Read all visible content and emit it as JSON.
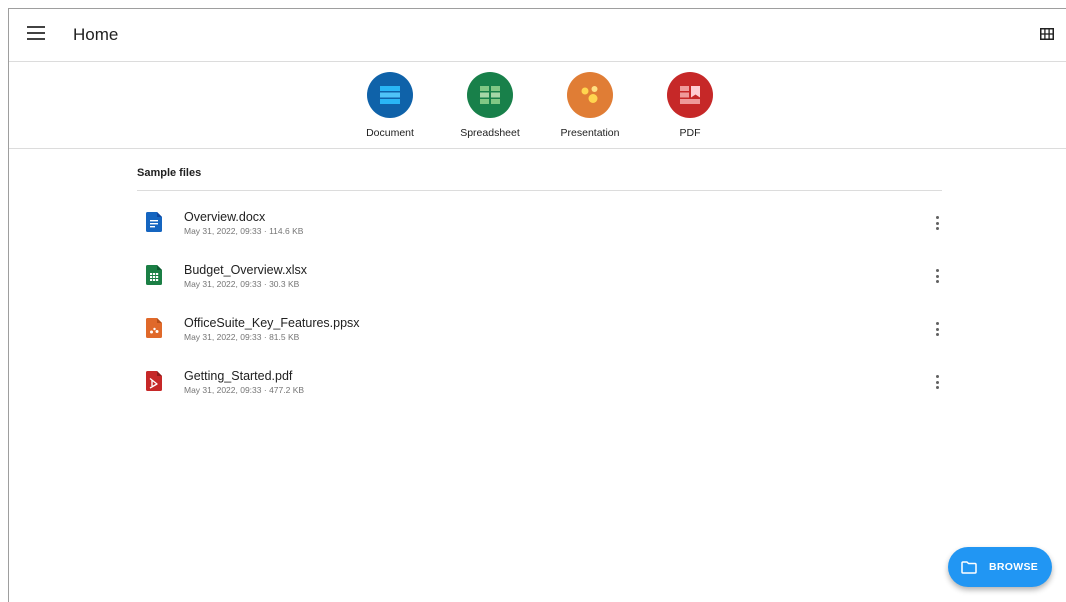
{
  "app": {
    "title": "Home"
  },
  "icons": {
    "menu": "menu-icon",
    "view_toggle": "grid-view-icon",
    "more": "more-vert-icon",
    "browse": "folder-icon"
  },
  "create": {
    "items": [
      {
        "label": "Document",
        "color": "#0f62a9",
        "icon": "document-icon"
      },
      {
        "label": "Spreadsheet",
        "color": "#18804a",
        "icon": "spreadsheet-icon"
      },
      {
        "label": "Presentation",
        "color": "#e07d35",
        "icon": "presentation-icon"
      },
      {
        "label": "PDF",
        "color": "#c62828",
        "icon": "pdf-icon"
      }
    ]
  },
  "section": {
    "title": "Sample files"
  },
  "files": [
    {
      "name": "Overview.docx",
      "date": "May 31, 2022, 09:33",
      "size": "114.6 KB",
      "type": "docx",
      "color": "#1565c0"
    },
    {
      "name": "Budget_Overview.xlsx",
      "date": "May 31, 2022, 09:33",
      "size": "30.3 KB",
      "type": "xlsx",
      "color": "#1b7f45"
    },
    {
      "name": "OfficeSuite_Key_Features.ppsx",
      "date": "May 31, 2022, 09:33",
      "size": "81.5 KB",
      "type": "ppsx",
      "color": "#e0692a"
    },
    {
      "name": "Getting_Started.pdf",
      "date": "May 31, 2022, 09:33",
      "size": "477.2 KB",
      "type": "pdf",
      "color": "#c62828"
    }
  ],
  "browse": {
    "label": "BROWSE",
    "color": "#2196f3"
  }
}
